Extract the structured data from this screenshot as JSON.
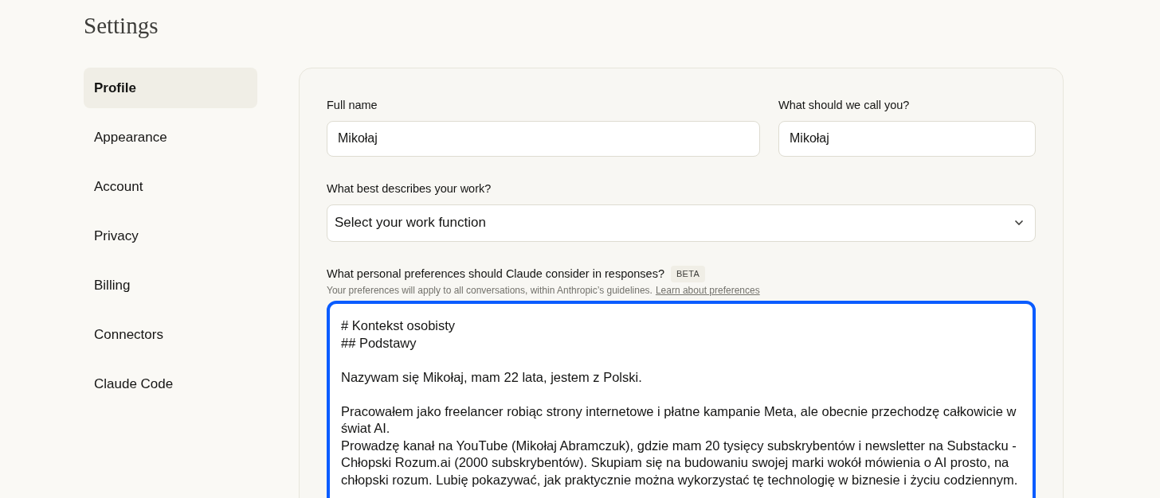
{
  "page": {
    "title": "Settings"
  },
  "sidebar": {
    "items": [
      {
        "label": "Profile",
        "selected": true
      },
      {
        "label": "Appearance",
        "selected": false
      },
      {
        "label": "Account",
        "selected": false
      },
      {
        "label": "Privacy",
        "selected": false
      },
      {
        "label": "Billing",
        "selected": false
      },
      {
        "label": "Connectors",
        "selected": false
      },
      {
        "label": "Claude Code",
        "selected": false
      }
    ]
  },
  "profile": {
    "full_name": {
      "label": "Full name",
      "value": "Mikołaj"
    },
    "nickname": {
      "label": "What should we call you?",
      "value": "Mikołaj"
    },
    "work_function": {
      "label": "What best describes your work?",
      "placeholder": "Select your work function"
    },
    "preferences": {
      "label": "What personal preferences should Claude consider in responses?",
      "badge": "BETA",
      "hint": "Your preferences will apply to all conversations, within Anthropic’s guidelines.",
      "link": "Learn about preferences",
      "focused": true,
      "value": "# Kontekst osobisty\n## Podstawy\n\nNazywam się Mikołaj, mam 22 lata, jestem z Polski.\n\nPracowałem jako freelancer robiąc strony internetowe i płatne kampanie Meta, ale obecnie przechodzę całkowicie w świat AI.\nProwadzę kanał na YouTube (Mikołaj Abramczuk), gdzie mam 20 tysięcy subskrybentów i newsletter na Substacku - Chłopski Rozum.ai (2000 subskrybentów). Skupiam się na budowaniu swojej marki wokół mówienia o AI prosto, na chłopski rozum. Lubię pokazywać, jak praktycznie można wykorzystać tę technologię w biznesie i życiu codziennym."
    }
  }
}
